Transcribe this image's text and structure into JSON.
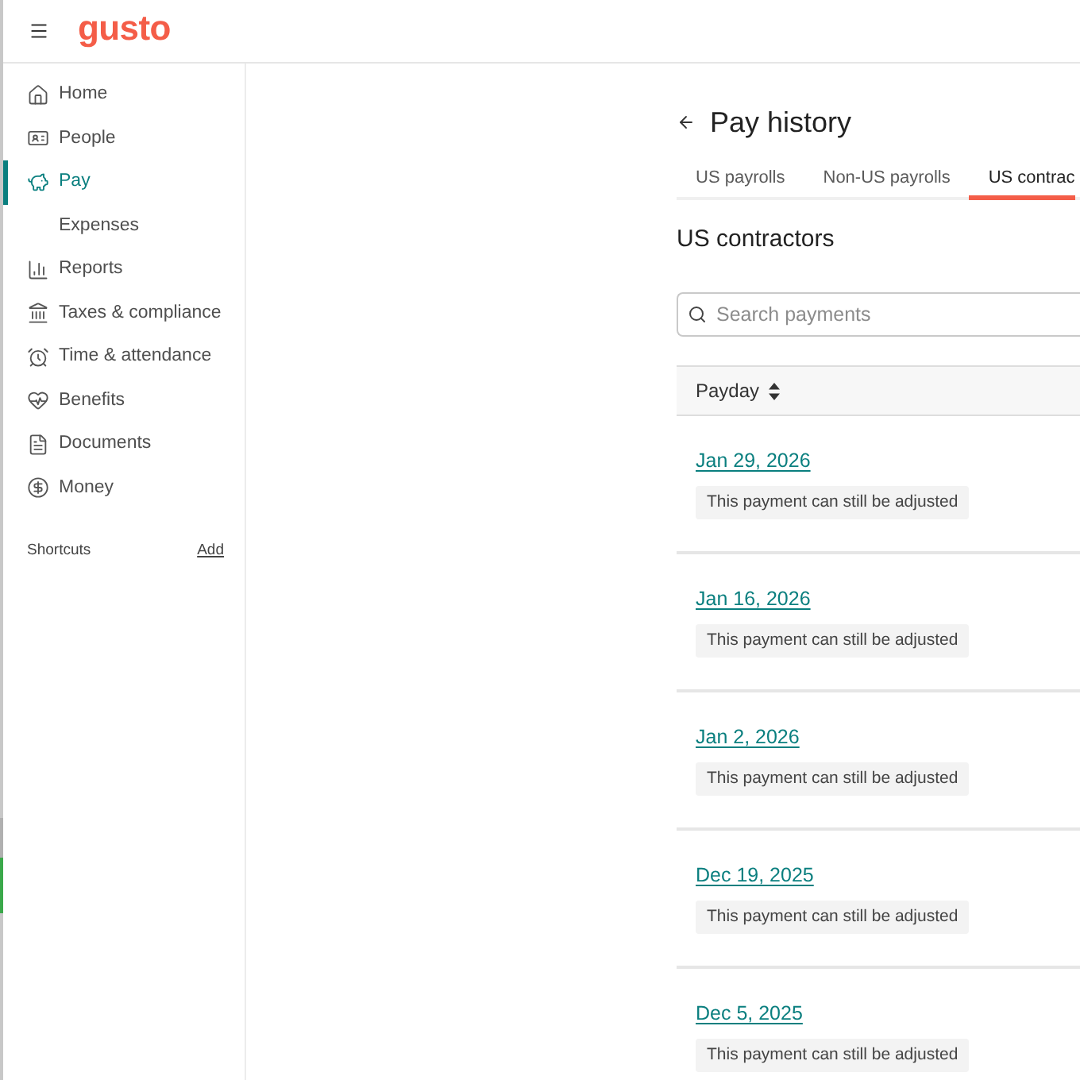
{
  "header": {
    "logo": "gusto"
  },
  "sidebar": {
    "items": [
      {
        "label": "Home",
        "selected": false
      },
      {
        "label": "People",
        "selected": false
      },
      {
        "label": "Pay",
        "selected": true,
        "children": [
          {
            "label": "Expenses",
            "selected": false
          }
        ]
      },
      {
        "label": "Reports",
        "selected": false
      },
      {
        "label": "Taxes & compliance",
        "selected": false
      },
      {
        "label": "Time & attendance",
        "selected": false
      },
      {
        "label": "Benefits",
        "selected": false
      },
      {
        "label": "Documents",
        "selected": false
      },
      {
        "label": "Money",
        "selected": false
      }
    ],
    "shortcuts": {
      "title": "Shortcuts",
      "action": "Add"
    }
  },
  "page": {
    "title": "Pay history",
    "tabs": [
      {
        "label": "US payrolls",
        "selected": false
      },
      {
        "label": "Non-US payrolls",
        "selected": false
      },
      {
        "label": "US contrac",
        "selected": true
      }
    ],
    "section_title": "US contractors",
    "search": {
      "placeholder": "Search payments"
    },
    "table": {
      "columns": [
        "Payday"
      ],
      "rows": [
        {
          "payday": "Jan 29, 2026",
          "status": "This payment can still be adjusted"
        },
        {
          "payday": "Jan 16, 2026",
          "status": "This payment can still be adjusted"
        },
        {
          "payday": "Jan 2, 2026",
          "status": "This payment can still be adjusted"
        },
        {
          "payday": "Dec 19, 2025",
          "status": "This payment can still be adjusted"
        },
        {
          "payday": "Dec 5, 2025",
          "status": "This payment can still be adjusted"
        }
      ]
    }
  }
}
